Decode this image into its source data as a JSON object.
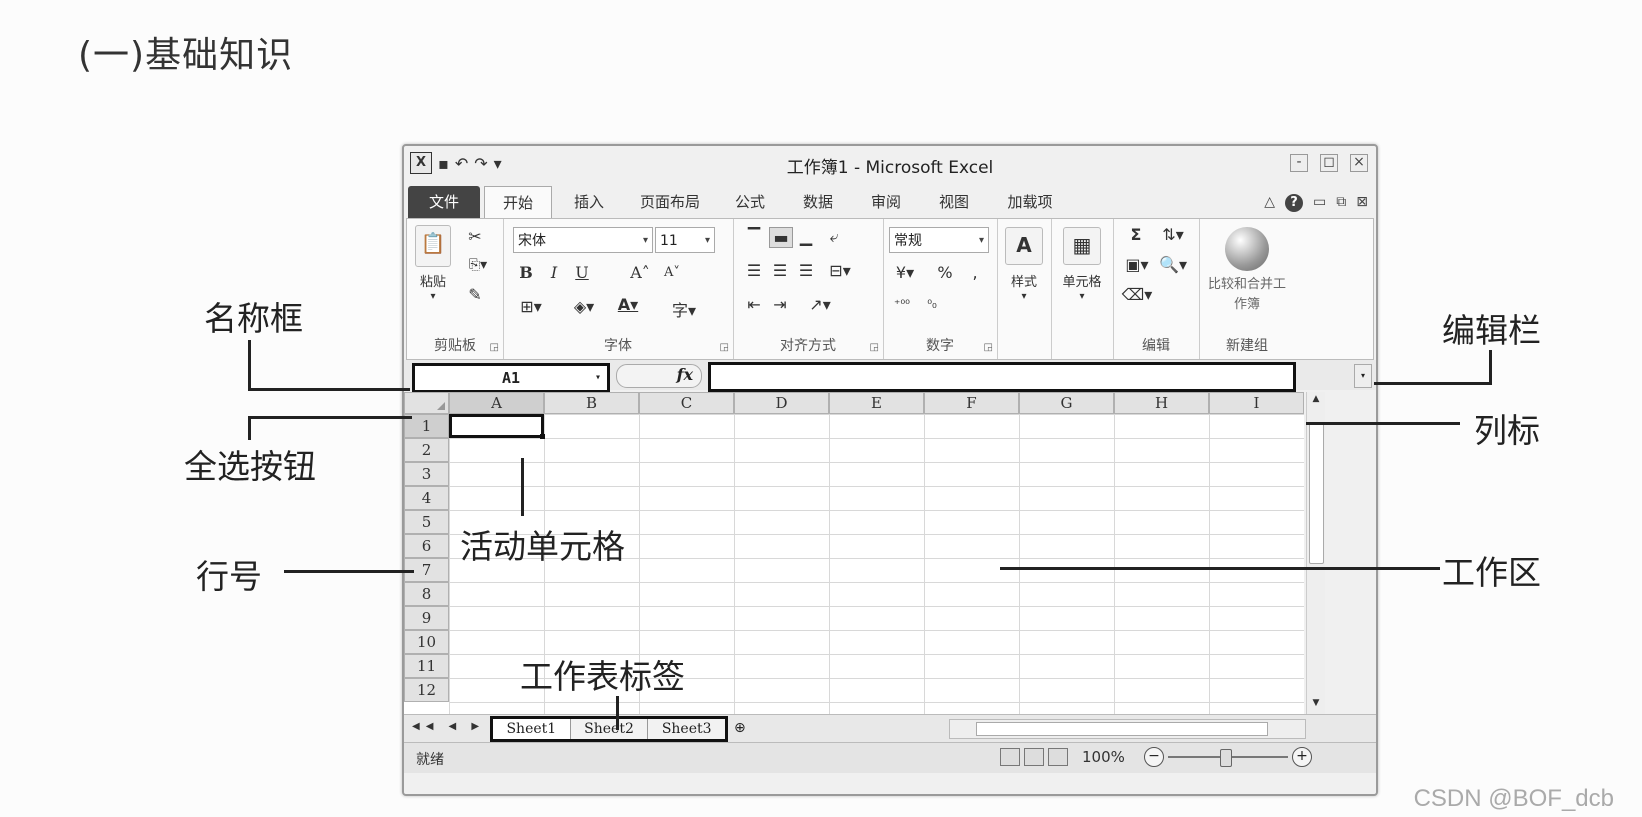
{
  "heading": "(一)基础知识",
  "watermark": "CSDN @BOF_dcb",
  "callouts": {
    "name_box": "名称框",
    "formula_bar": "编辑栏",
    "column_header": "列标",
    "select_all": "全选按钮",
    "active_cell": "活动单元格",
    "row_number": "行号",
    "work_area": "工作区",
    "sheet_tabs": "工作表标签"
  },
  "window": {
    "title": "工作簿1 - Microsoft Excel",
    "app_logo": "X",
    "qat": {
      "undo": "↶",
      "redo": "↷"
    },
    "controls": {
      "minimize": "-",
      "restore": "◻",
      "close": "×"
    }
  },
  "tabs": [
    "文件",
    "开始",
    "插入",
    "页面布局",
    "公式",
    "数据",
    "审阅",
    "视图",
    "加载项"
  ],
  "ribbon": {
    "clipboard": {
      "label": "剪贴板",
      "paste": "粘贴"
    },
    "font": {
      "label": "字体",
      "font_name": "宋体",
      "font_size": "11",
      "bold": "B",
      "italic": "I",
      "underline": "U"
    },
    "alignment": {
      "label": "对齐方式"
    },
    "number": {
      "label": "数字",
      "format": "常规",
      "percent": "%"
    },
    "styles": {
      "label": "样式"
    },
    "cells": {
      "label": "单元格"
    },
    "editing": {
      "label": "编辑",
      "sum": "Σ"
    },
    "compare": {
      "label": "新建组",
      "button": "比较和合并工作簿"
    }
  },
  "formula_bar": {
    "name_box": "A1",
    "fx": "fx",
    "value": ""
  },
  "columns": [
    "A",
    "B",
    "C",
    "D",
    "E",
    "F",
    "G",
    "H",
    "I"
  ],
  "rows": [
    "1",
    "2",
    "3",
    "4",
    "5",
    "6",
    "7",
    "8",
    "9",
    "10",
    "11",
    "12"
  ],
  "sheets": [
    "Sheet1",
    "Sheet2",
    "Sheet3"
  ],
  "status": {
    "text": "就绪",
    "zoom": "100%"
  }
}
